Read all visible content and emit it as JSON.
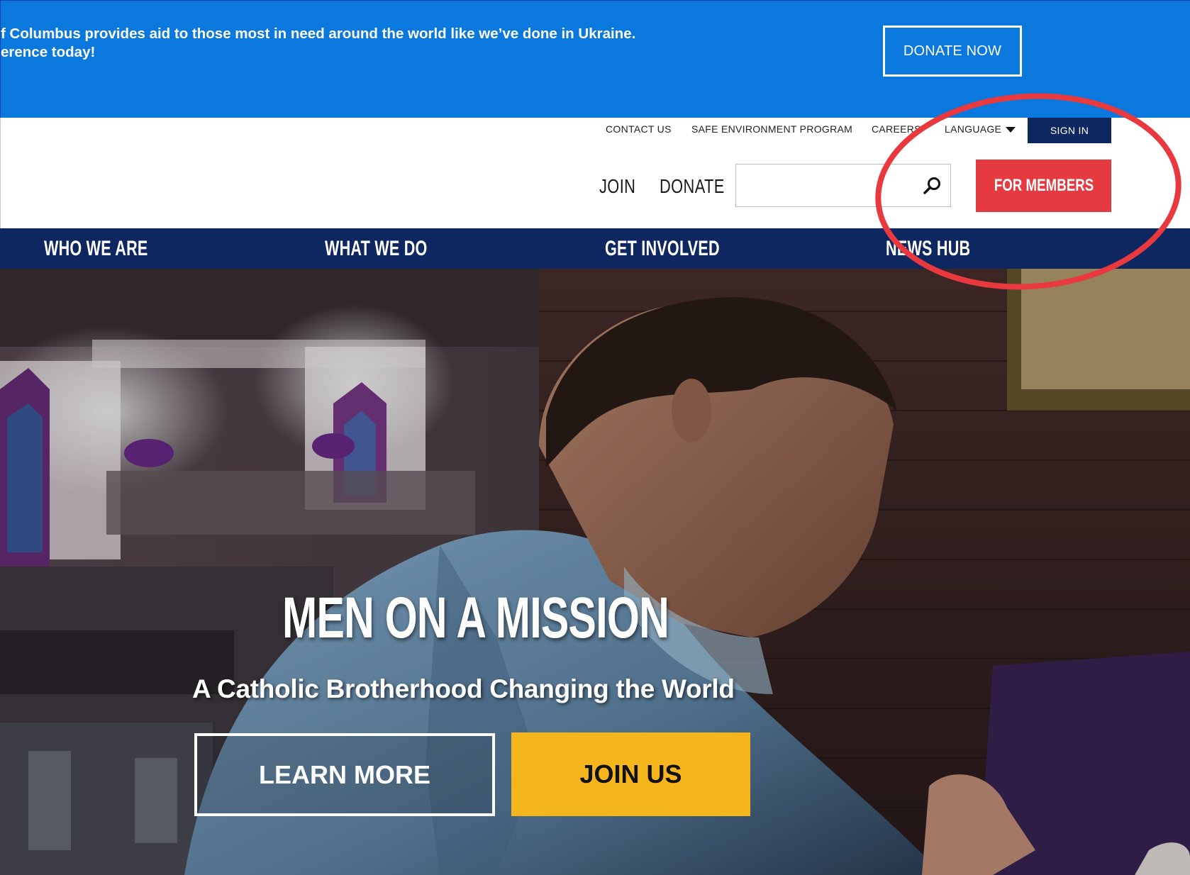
{
  "banner": {
    "line1": "f Columbus provides aid to those most in need around the world like we’ve done in Ukraine.",
    "line2": "erence today!",
    "donate_now": "DONATE NOW"
  },
  "utility_nav": {
    "contact_us": "CONTACT US",
    "safe_environment": "SAFE ENVIRONMENT PROGRAM",
    "careers": "CAREERS",
    "language": "LANGUAGE",
    "sign_in": "SIGN IN"
  },
  "header": {
    "join": "JOIN",
    "donate": "DONATE",
    "search_value": "",
    "for_members": "FOR MEMBERS"
  },
  "main_nav": {
    "items": [
      {
        "label": "WHO WE ARE"
      },
      {
        "label": "WHAT WE DO"
      },
      {
        "label": "GET INVOLVED"
      },
      {
        "label": "NEWS HUB"
      }
    ]
  },
  "hero": {
    "title": "MEN ON A MISSION",
    "subtitle": "A Catholic Brotherhood Changing the World",
    "learn_more": "LEARN MORE",
    "join_us": "JOIN US"
  },
  "colors": {
    "banner_blue": "#0a78dc",
    "navy": "#0f2760",
    "for_members_red": "#e53a3f",
    "join_us_yellow": "#f5b51c",
    "annotation_red": "#e8393f"
  },
  "icons": [
    "search-icon",
    "caret-down-icon"
  ]
}
